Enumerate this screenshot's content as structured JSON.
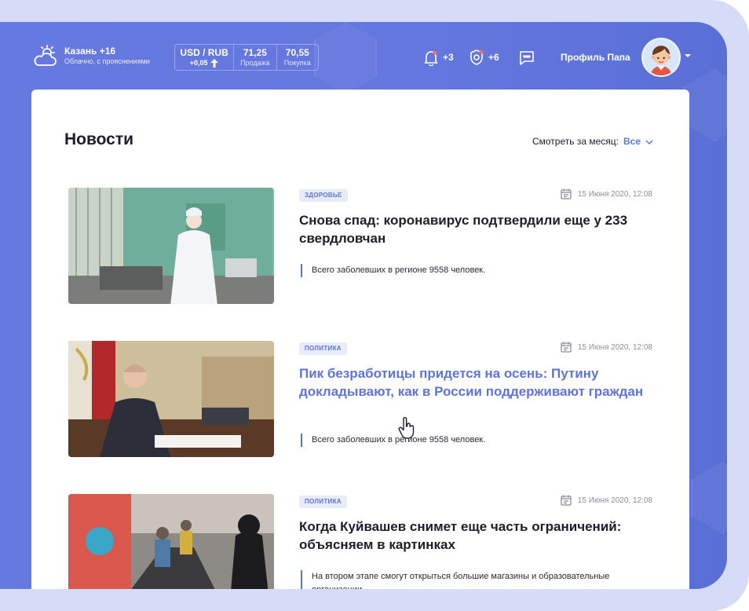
{
  "weather": {
    "city": "Казань +16",
    "description": "Облачно, с прояснениями"
  },
  "currency": {
    "pair": "USD / RUB",
    "delta": "+0,05",
    "sell_value": "71,25",
    "sell_label": "Продажа",
    "buy_value": "70,55",
    "buy_label": "Покупка"
  },
  "notifications": {
    "bell_count": "+3",
    "shield_count": "+6"
  },
  "profile": {
    "name": "Профиль Папа"
  },
  "page": {
    "title": "Новости",
    "filter_label": "Смотреть за месяц:",
    "filter_value": "Все"
  },
  "news": [
    {
      "tag": "ЗДОРОВЬЕ",
      "date": "15 Июня 2020, 12:08",
      "title": "Снова спад: коронавирус подтвердили еще у 233 свердловчан",
      "summary": "Всего заболевших в регионе 9558 человек."
    },
    {
      "tag": "ПОЛИТИКА",
      "date": "15 Июня 2020, 12:08",
      "title": "Пик безработицы придется на осень: Путину докладывают, как в России поддерживают граждан",
      "summary": "Всего заболевших в регионе 9558 человек."
    },
    {
      "tag": "ПОЛИТИКА",
      "date": "15 Июня 2020, 12:08",
      "title": "Когда Куйвашев снимет еще часть ограничений: объясняем в картинках",
      "summary": "На втором этапе смогут открыться большие магазины и образовательные организации"
    }
  ],
  "colors": {
    "accent": "#5e74dc",
    "background_blue": "#6377de",
    "text_dark": "#1d1d2c",
    "muted": "#8b8d98"
  }
}
